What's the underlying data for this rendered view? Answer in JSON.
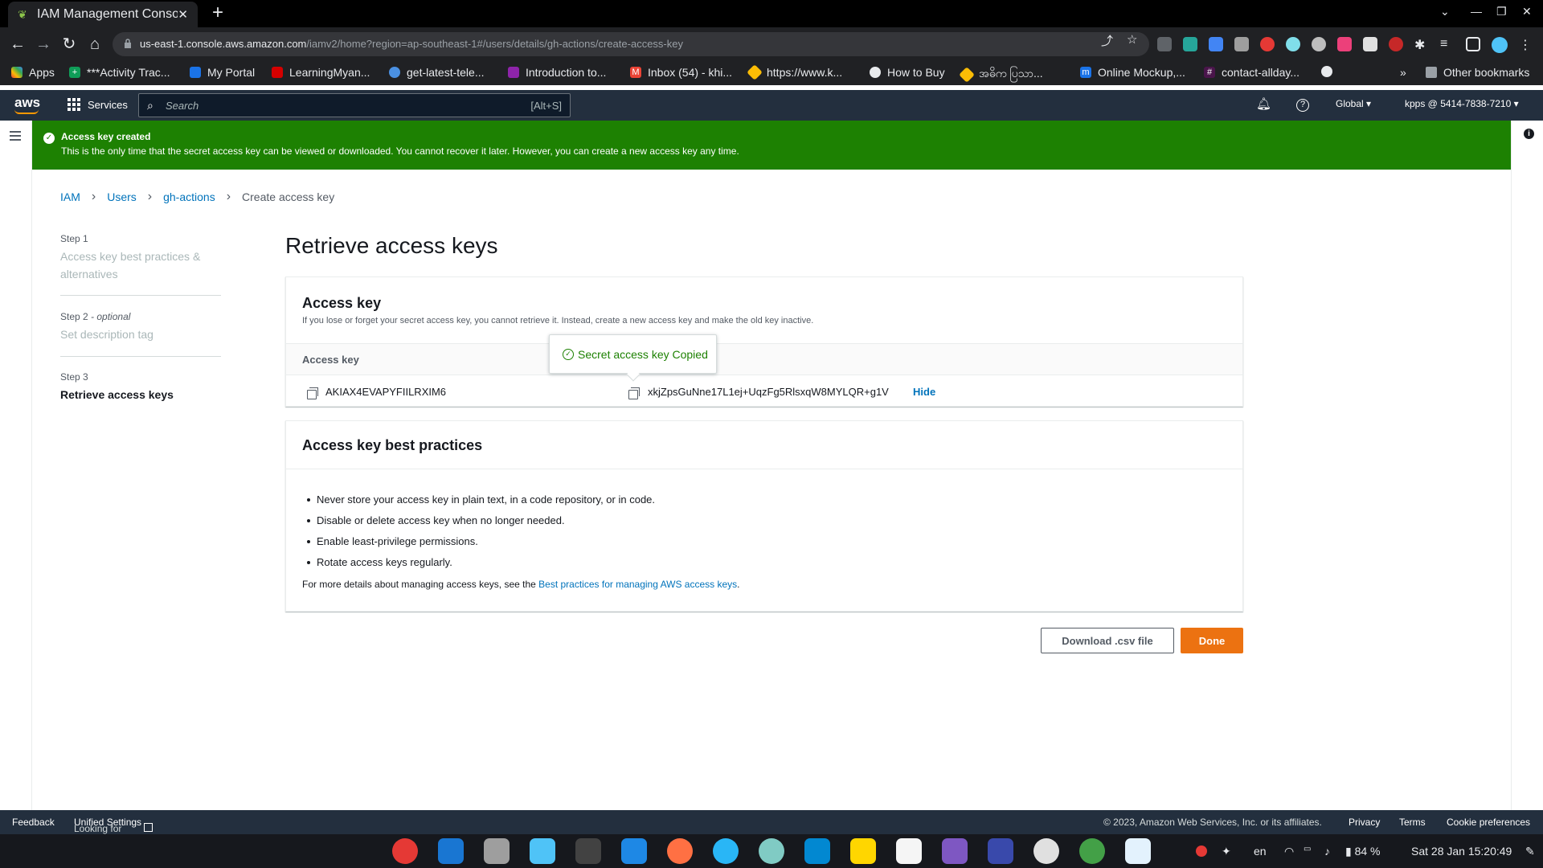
{
  "browser": {
    "tab_title": "IAM Management Console",
    "new_tab_icon": "plus-icon",
    "url_host": "us-east-1.console.aws.amazon.com",
    "url_path": "/iamv2/home?region=ap-southeast-1#/users/details/gh-actions/create-access-key",
    "bookmarks": [
      "Apps",
      "***Activity Trac...",
      "My Portal",
      "LearningMyan...",
      "get-latest-tele...",
      "Introduction to...",
      "Inbox (54) - khi...",
      "https://www.k...",
      "How to Buy",
      "အဓိက ပြသာ...",
      "Online Mockup,...",
      "contact-allday..."
    ],
    "other_bookmarks": "Other bookmarks",
    "more_bookmarks": "»"
  },
  "aws_header": {
    "logo": "aws",
    "services": "Services",
    "search_placeholder": "Search",
    "search_shortcut": "[Alt+S]",
    "region": "Global ▾",
    "account": "kpps @ 5414-7838-7210 ▾"
  },
  "flash": {
    "title": "Access key created",
    "message": "This is the only time that the secret access key can be viewed or downloaded. You cannot recover it later. However, you can create a new access key any time."
  },
  "breadcrumb": {
    "items": [
      "IAM",
      "Users",
      "gh-actions"
    ],
    "current": "Create access key"
  },
  "steps": [
    {
      "label": "Step 1",
      "optional": "",
      "text": "Access key best practices & alternatives"
    },
    {
      "label": "Step 2",
      "optional": "- optional",
      "text": "Set description tag"
    },
    {
      "label": "Step 3",
      "optional": "",
      "text": "Retrieve access keys"
    }
  ],
  "page_title": "Retrieve access keys",
  "access_key_card": {
    "title": "Access key",
    "description": "If you lose or forget your secret access key, you cannot retrieve it. Instead, create a new access key and make the old key inactive.",
    "column": "Access key",
    "access_key_id": "AKIAX4EVAPYFIILRXIM6",
    "secret_key": "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",
    "hide_label": "Hide",
    "popover": "Secret access key Copied"
  },
  "best_practices": {
    "title": "Access key best practices",
    "items": [
      "Never store your access key in plain text, in a code repository, or in code.",
      "Disable or delete access key when no longer needed.",
      "Enable least-privilege permissions.",
      "Rotate access keys regularly."
    ],
    "more_prefix": "For more details about managing access keys, see the ",
    "more_link": "Best practices for managing AWS access keys",
    "more_suffix": "."
  },
  "actions": {
    "download": "Download .csv file",
    "done": "Done"
  },
  "footer": {
    "feedback": "Feedback",
    "language_note": "Looking for language selection? Find it in the new",
    "unified": "Unified Settings",
    "copyright": "© 2023, Amazon Web Services, Inc. or its affiliates.",
    "privacy": "Privacy",
    "terms": "Terms",
    "cookies": "Cookie preferences"
  },
  "system_tray": {
    "lang": "en",
    "battery": "84 %",
    "datetime": "Sat 28 Jan  15:20:49"
  },
  "colors": {
    "aws_nav": "#232f3e",
    "success": "#1d8102",
    "link": "#0073bb",
    "primary_button": "#ec7211"
  }
}
